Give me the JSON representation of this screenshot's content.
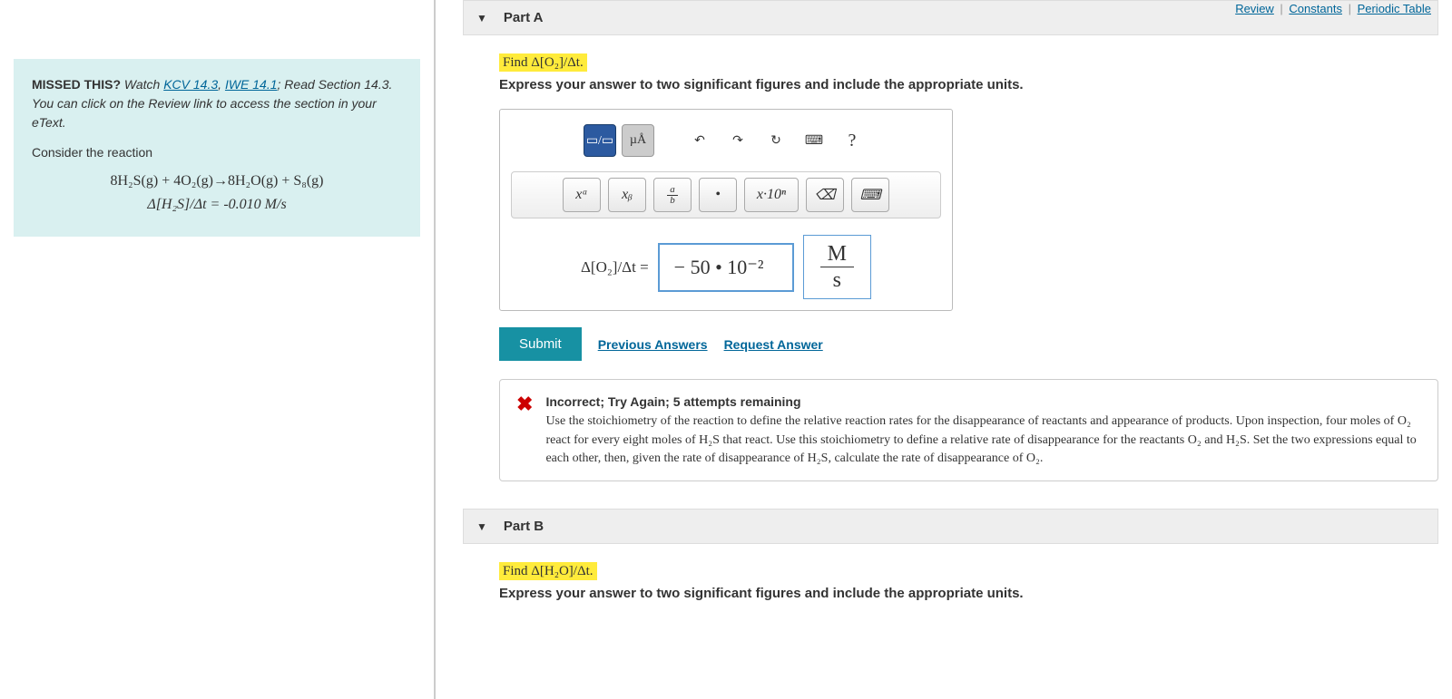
{
  "topLinks": {
    "review": "Review",
    "constants": "Constants",
    "periodic": "Periodic Table"
  },
  "left": {
    "missedPrefix": "MISSED THIS?",
    "missedWatch": " Watch ",
    "kcv": "KCV 14.3",
    "iwe": "IWE 14.1",
    "missedTail": "; Read Section 14.3. You can click on the Review link to access the section in your eText.",
    "consider": "Consider the reaction",
    "equation": "8H₂S(g) + 4O₂(g)→8H₂O(g) + S₈(g)",
    "rate": "Δ[H₂S]/Δt = -0.010 M/s"
  },
  "partA": {
    "title": "Part A",
    "findPre": "Find ",
    "findExpr": "Δ[O₂]/Δt.",
    "instruction": "Express your answer to two significant figures and include the appropriate units.",
    "toolbar1": {
      "tpl": "▭/▭",
      "units": "µÅ",
      "undo": "↶",
      "redo": "↷",
      "reset": "↻",
      "keyboard": "⌨",
      "help": "?"
    },
    "toolbar2": {
      "xa": "xᵃ",
      "xb": "xᵦ",
      "ab": "a/b",
      "dot": "•",
      "sci": "x·10ⁿ",
      "backspace": "⌫",
      "kbd": "⌨"
    },
    "answerLabel": "Δ[O₂]/Δt =",
    "answerValue": "− 50 • 10⁻²",
    "unitNum": "M",
    "unitDen": "s",
    "submit": "Submit",
    "prevAnswers": "Previous Answers",
    "requestAnswer": "Request Answer",
    "feedback": {
      "head": "Incorrect; Try Again; 5 attempts remaining",
      "body": "Use the stoichiometry of the reaction to define the relative reaction rates for the disappearance of reactants and appearance of products. Upon inspection, four moles of O₂ react for every eight moles of H₂S that react. Use this stoichiometry to define a relative rate of disappearance for the reactants O₂ and H₂S. Set the two expressions equal to each other, then, given the rate of disappearance of H₂S, calculate the rate of disappearance of O₂."
    }
  },
  "partB": {
    "title": "Part B",
    "findPre": "Find ",
    "findExpr": "Δ[H₂O]/Δt.",
    "instruction": "Express your answer to two significant figures and include the appropriate units."
  }
}
